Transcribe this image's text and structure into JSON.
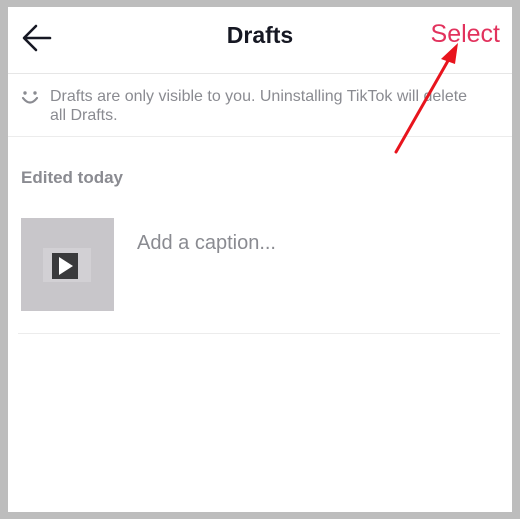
{
  "header": {
    "title": "Drafts",
    "select_label": "Select",
    "back_icon": "arrow-left-icon"
  },
  "notice": {
    "icon": "smile-icon",
    "text": "Drafts are only visible to you. Uninstalling TikTok will delete all Drafts."
  },
  "drafts": {
    "section_label": "Edited today",
    "items": [
      {
        "caption_placeholder": "Add a caption...",
        "thumbnail_icon": "play-icon"
      }
    ]
  },
  "annotation": {
    "arrow_color": "#e8141d",
    "target": "Select"
  },
  "colors": {
    "accent": "#e2325d",
    "text_primary": "#161823",
    "text_secondary": "#8a8b91"
  }
}
